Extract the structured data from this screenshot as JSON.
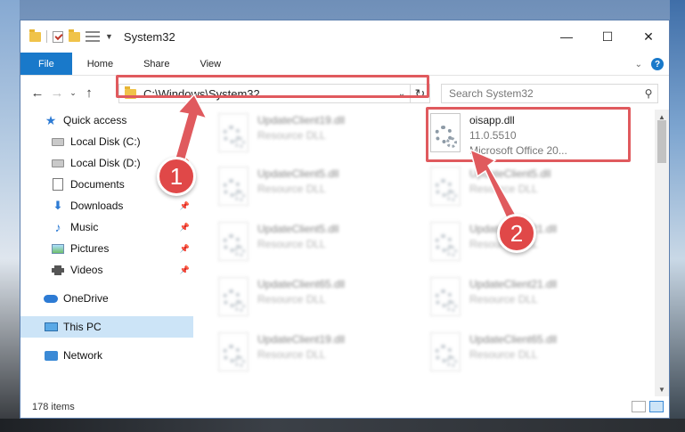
{
  "window": {
    "title": "System32",
    "controls": {
      "minimize": "—",
      "maximize": "☐",
      "close": "✕"
    }
  },
  "ribbon": {
    "tabs": [
      "File",
      "Home",
      "Share",
      "View"
    ],
    "help": "?"
  },
  "navigation": {
    "back": "←",
    "forward": "→",
    "recent": "⌄",
    "up": "↑",
    "address": "C:\\Windows\\System32",
    "search_placeholder": "Search System32"
  },
  "sidebar": {
    "items": [
      {
        "label": "Quick access",
        "icon": "star-icon",
        "pinned": false
      },
      {
        "label": "Local Disk (C:)",
        "icon": "drive-icon",
        "pinned": false
      },
      {
        "label": "Local Disk (D:)",
        "icon": "drive-icon",
        "pinned": true
      },
      {
        "label": "Documents",
        "icon": "documents-icon",
        "pinned": true
      },
      {
        "label": "Downloads",
        "icon": "downloads-icon",
        "pinned": true
      },
      {
        "label": "Music",
        "icon": "music-icon",
        "pinned": true
      },
      {
        "label": "Pictures",
        "icon": "pictures-icon",
        "pinned": true
      },
      {
        "label": "Videos",
        "icon": "videos-icon",
        "pinned": true
      },
      {
        "label": "OneDrive",
        "icon": "onedrive-icon",
        "pinned": false
      },
      {
        "label": "This PC",
        "icon": "this-pc-icon",
        "pinned": false,
        "selected": true
      },
      {
        "label": "Network",
        "icon": "network-icon",
        "pinned": false
      }
    ]
  },
  "files": [
    {
      "name": "UpdateClient19.dll",
      "line2": "Resource DLL",
      "line3": "",
      "blurred": true
    },
    {
      "name": "oisapp.dll",
      "line2": "11.0.5510",
      "line3": "Microsoft Office 20...",
      "blurred": false
    },
    {
      "name": "UpdateClient5.dll",
      "line2": "Resource DLL",
      "line3": "",
      "blurred": true
    },
    {
      "name": "UpdateClient5.dll",
      "line2": "Resource DLL",
      "line3": "",
      "blurred": true
    },
    {
      "name": "UpdateClient5.dll",
      "line2": "Resource DLL",
      "line3": "",
      "blurred": true
    },
    {
      "name": "UpdateClient21.dll",
      "line2": "Resource DLL",
      "line3": "",
      "blurred": true
    },
    {
      "name": "UpdateClient65.dll",
      "line2": "Resource DLL",
      "line3": "",
      "blurred": true
    },
    {
      "name": "UpdateClient21.dll",
      "line2": "Resource DLL",
      "line3": "",
      "blurred": true
    },
    {
      "name": "UpdateClient19.dll",
      "line2": "Resource DLL",
      "line3": "",
      "blurred": true
    },
    {
      "name": "UpdateClient65.dll",
      "line2": "Resource DLL",
      "line3": "",
      "blurred": true
    }
  ],
  "status": {
    "item_count": "178 items"
  },
  "annotations": {
    "step1": "1",
    "step2": "2",
    "color": "#e05a5e"
  }
}
